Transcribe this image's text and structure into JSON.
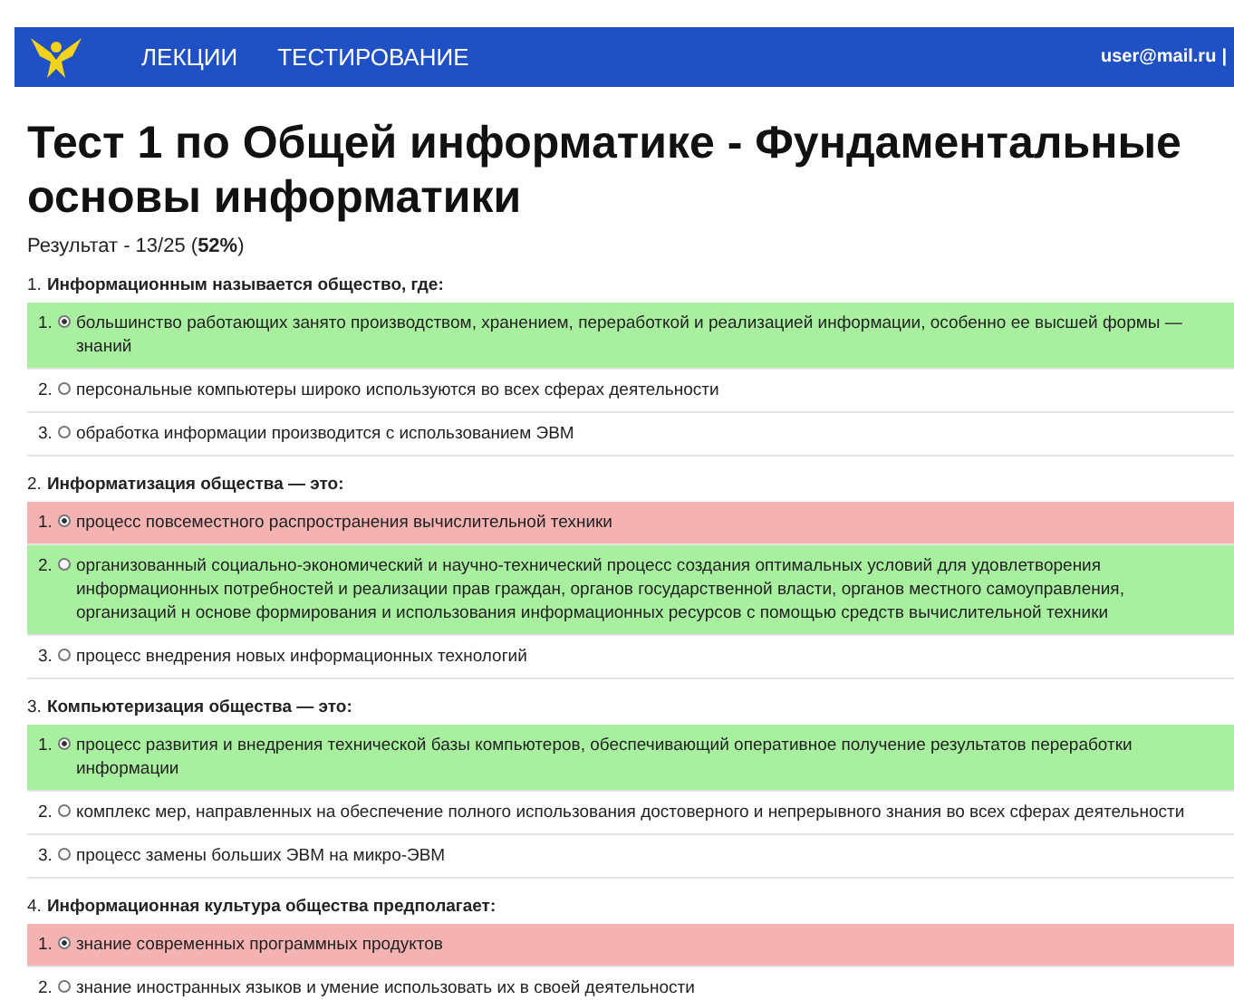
{
  "nav": {
    "items": [
      {
        "label": "ЛЕКЦИИ"
      },
      {
        "label": "ТЕСТИРОВАНИЕ"
      }
    ],
    "user": "user@mail.ru",
    "separator": "|"
  },
  "title": "Тест 1 по Общей информатике - Фундаментальные основы информатики",
  "result": "Результат - 13/25 (**52%**)",
  "questions": [
    {
      "number": "1.",
      "text": "Информационным называется общество, где:",
      "options": [
        {
          "number": "1.",
          "text": "большинство работающих занято производством, хранением, переработкой и реализацией информации, особенно ее высшей формы — знаний",
          "selected": true,
          "color": "#a8f0a0"
        },
        {
          "number": "2.",
          "text": "персональные компьютеры широко используются во всех сферах деятельности",
          "selected": false
        },
        {
          "number": "3.",
          "text": "обработка информации производится с использованием ЭВМ",
          "selected": false
        }
      ]
    },
    {
      "number": "2.",
      "text": "Информатизация общества — это:",
      "options": [
        {
          "number": "1.",
          "text": "процесс повсеместного распространения вычислительной техники",
          "selected": true,
          "color": "#f5b2b2"
        },
        {
          "number": "2.",
          "text": "организованный социально-экономический и научно-технический процесс создания оптимальных условий для удовлетворения информационных потребностей и реализации прав граждан, органов государственной власти, органов местного самоуправления, организаций н основе формирования и использования информационных ресурсов с помощью средств вычислительной техники",
          "selected": false,
          "color": "#a8f0a0"
        },
        {
          "number": "3.",
          "text": "процесс внедрения новых информационных технологий",
          "selected": false
        }
      ]
    },
    {
      "number": "3.",
      "text": "Компьютеризация общества — это:",
      "options": [
        {
          "number": "1.",
          "text": "процесс развития и внедрения технической базы компьютеров, обеспечивающий оперативное получение результатов переработки информации",
          "selected": true,
          "color": "#a8f0a0"
        },
        {
          "number": "2.",
          "text": "комплекс мер, направленных на обеспечение полного использования достоверного и непрерывного знания во всех сферах деятельности",
          "selected": false
        },
        {
          "number": "3.",
          "text": "процесс замены больших ЭВМ на микро-ЭВМ",
          "selected": false
        }
      ]
    },
    {
      "number": "4.",
      "text": "Информационная культура общества предполагает:",
      "options": [
        {
          "number": "1.",
          "text": "знание современных программных продуктов",
          "selected": true,
          "color": "#f5b2b2"
        },
        {
          "number": "2.",
          "text": "знание иностранных языков и умение использовать их в своей деятельности",
          "selected": false
        }
      ]
    }
  ]
}
